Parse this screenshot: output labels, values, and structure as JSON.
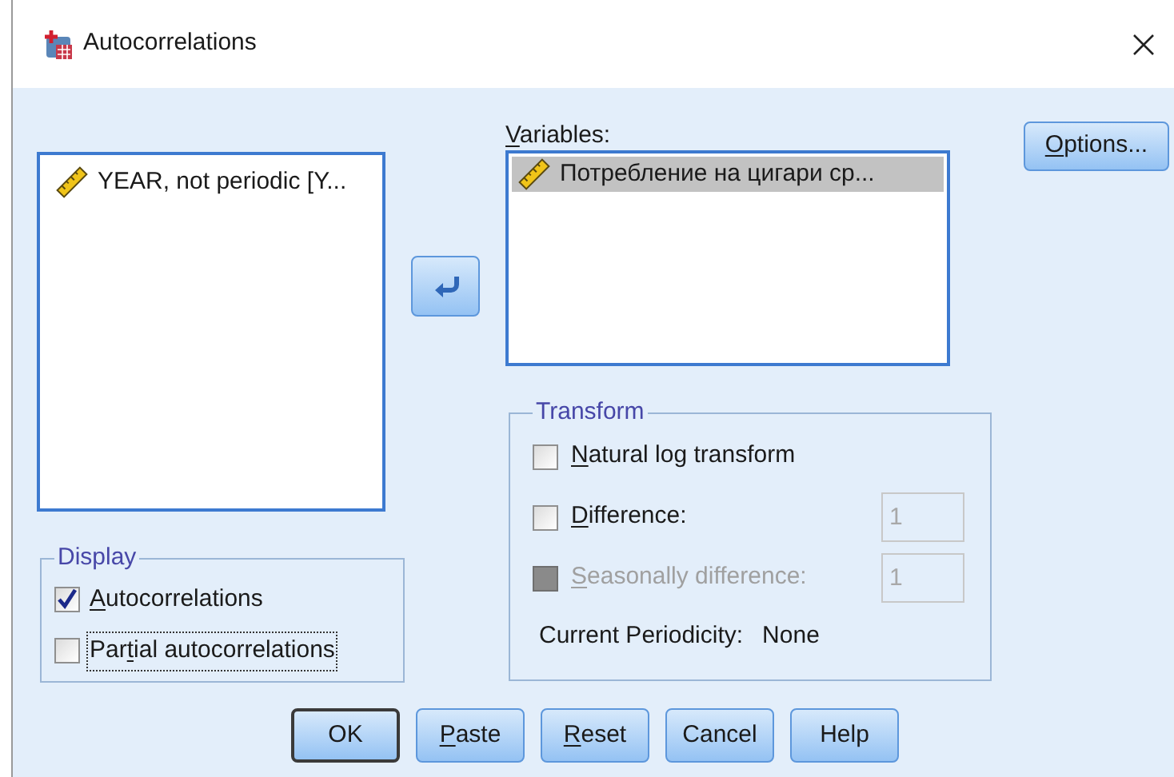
{
  "window": {
    "title": "Autocorrelations"
  },
  "source_list": {
    "items": [
      {
        "label": "YEAR, not periodic [Y...",
        "selected": false
      }
    ]
  },
  "variables": {
    "label": [
      {
        "text": "V",
        "underline": true
      },
      {
        "text": "ariables:",
        "underline": false
      }
    ],
    "items": [
      {
        "label": "Потребление на цигари ср...",
        "selected": true
      }
    ]
  },
  "options_button": {
    "label": [
      {
        "text": "O",
        "underline": true
      },
      {
        "text": "ptions...",
        "underline": false
      }
    ]
  },
  "transform": {
    "title": "Transform",
    "options": [
      {
        "label": [
          {
            "text": "N",
            "underline": true
          },
          {
            "text": "atural log transform",
            "underline": false
          }
        ],
        "checked": false,
        "disabled": false
      },
      {
        "label": [
          {
            "text": "D",
            "underline": true
          },
          {
            "text": "ifference:",
            "underline": false
          }
        ],
        "checked": false,
        "disabled": false,
        "field": {
          "value": "1",
          "disabled": true
        }
      },
      {
        "label": [
          {
            "text": "S",
            "underline": true
          },
          {
            "text": "easonally difference:",
            "underline": false
          }
        ],
        "checked": false,
        "disabled": true,
        "field": {
          "value": "1",
          "disabled": true
        }
      }
    ],
    "periodicity": {
      "label": "Current Periodicity:",
      "value": "None"
    }
  },
  "display": {
    "title": "Display",
    "options": [
      {
        "label": [
          {
            "text": "A",
            "underline": true
          },
          {
            "text": "utocorrelations",
            "underline": false
          }
        ],
        "checked": true,
        "focused": false
      },
      {
        "label": [
          {
            "text": "Par",
            "underline": false
          },
          {
            "text": "t",
            "underline": true
          },
          {
            "text": "ial autocorrelations",
            "underline": false
          }
        ],
        "checked": false,
        "focused": true
      }
    ]
  },
  "buttons": [
    {
      "label": [
        {
          "text": "OK",
          "underline": false
        }
      ],
      "default": true
    },
    {
      "label": [
        {
          "text": "P",
          "underline": true
        },
        {
          "text": "aste",
          "underline": false
        }
      ],
      "default": false
    },
    {
      "label": [
        {
          "text": "R",
          "underline": true
        },
        {
          "text": "eset",
          "underline": false
        }
      ],
      "default": false
    },
    {
      "label": [
        {
          "text": "Cancel",
          "underline": false
        }
      ],
      "default": false
    },
    {
      "label": [
        {
          "text": "Help",
          "underline": false
        }
      ],
      "default": false
    }
  ]
}
